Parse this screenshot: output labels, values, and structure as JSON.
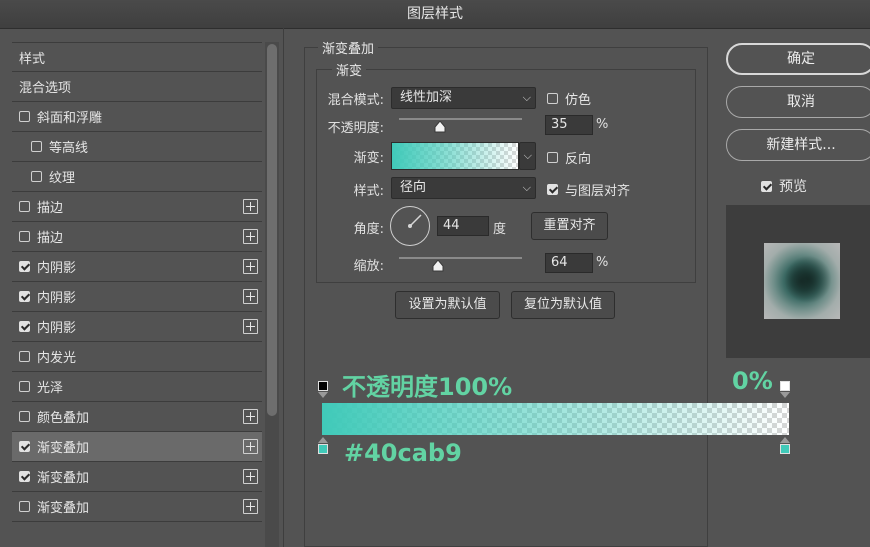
{
  "window": {
    "title": "图层样式"
  },
  "style_list": [
    {
      "label": "样式",
      "checkbox": false,
      "indent": 0,
      "plus": false
    },
    {
      "label": "混合选项",
      "checkbox": false,
      "indent": 0,
      "plus": false
    },
    {
      "label": "斜面和浮雕",
      "checkbox": true,
      "checked": false,
      "indent": 0,
      "plus": false
    },
    {
      "label": "等高线",
      "checkbox": true,
      "checked": false,
      "indent": 1,
      "plus": false
    },
    {
      "label": "纹理",
      "checkbox": true,
      "checked": false,
      "indent": 1,
      "plus": false
    },
    {
      "label": "描边",
      "checkbox": true,
      "checked": false,
      "indent": 0,
      "plus": true
    },
    {
      "label": "描边",
      "checkbox": true,
      "checked": false,
      "indent": 0,
      "plus": true
    },
    {
      "label": "内阴影",
      "checkbox": true,
      "checked": true,
      "indent": 0,
      "plus": true
    },
    {
      "label": "内阴影",
      "checkbox": true,
      "checked": true,
      "indent": 0,
      "plus": true
    },
    {
      "label": "内阴影",
      "checkbox": true,
      "checked": true,
      "indent": 0,
      "plus": true
    },
    {
      "label": "内发光",
      "checkbox": true,
      "checked": false,
      "indent": 0,
      "plus": false
    },
    {
      "label": "光泽",
      "checkbox": true,
      "checked": false,
      "indent": 0,
      "plus": false
    },
    {
      "label": "颜色叠加",
      "checkbox": true,
      "checked": false,
      "indent": 0,
      "plus": true
    },
    {
      "label": "渐变叠加",
      "checkbox": true,
      "checked": true,
      "indent": 0,
      "plus": true,
      "selected": true
    },
    {
      "label": "渐变叠加",
      "checkbox": true,
      "checked": true,
      "indent": 0,
      "plus": true
    },
    {
      "label": "渐变叠加",
      "checkbox": true,
      "checked": false,
      "indent": 0,
      "plus": true
    }
  ],
  "panel": {
    "outer_title": "渐变叠加",
    "inner_title": "渐变",
    "blend_mode_label": "混合模式:",
    "blend_mode_value": "线性加深",
    "dither_label": "仿色",
    "dither_checked": false,
    "opacity_label": "不透明度:",
    "opacity_value": "35",
    "opacity_unit": "%",
    "gradient_label": "渐变:",
    "reverse_label": "反向",
    "reverse_checked": false,
    "style_label": "样式:",
    "style_value": "径向",
    "align_label": "与图层对齐",
    "align_checked": true,
    "angle_label": "角度:",
    "angle_value": "44",
    "angle_unit": "度",
    "reset_align_label": "重置对齐",
    "scale_label": "缩放:",
    "scale_value": "64",
    "scale_unit": "%",
    "set_default_label": "设置为默认值",
    "reset_default_label": "复位为默认值"
  },
  "right": {
    "ok_label": "确定",
    "cancel_label": "取消",
    "new_style_label": "新建样式...",
    "preview_label": "预览",
    "preview_checked": true
  },
  "gradient_editor": {
    "opacity_annotation": "不透明度100%",
    "end_opacity_annotation": "0%",
    "color_annotation": "#40cab9",
    "color": "#40cab9",
    "annotation_color": "#62d3a3"
  }
}
